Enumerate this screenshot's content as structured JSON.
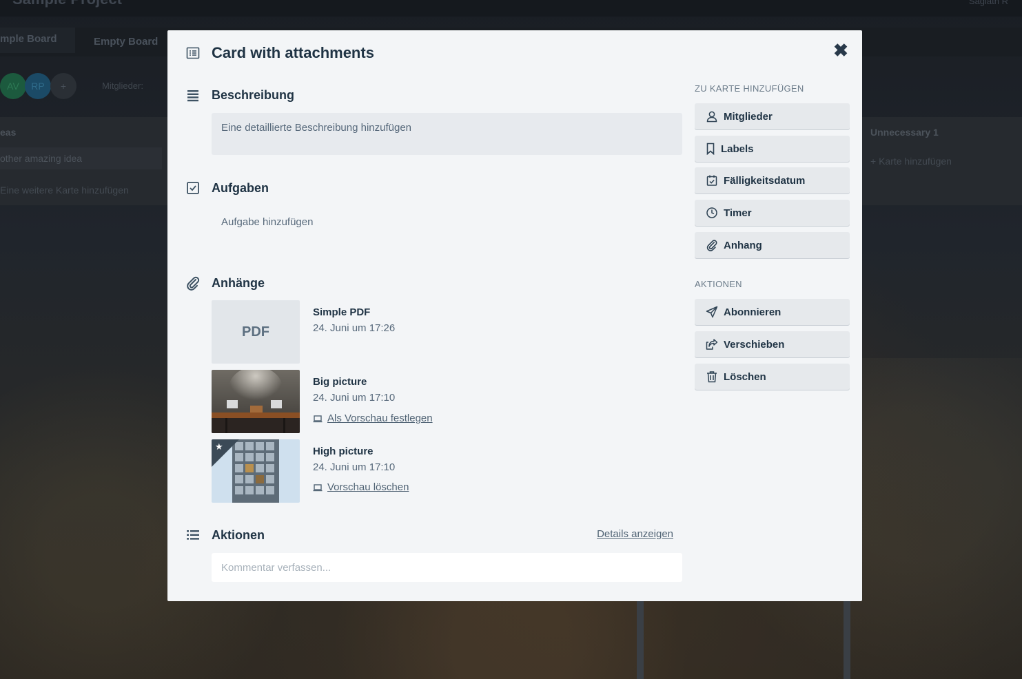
{
  "background": {
    "project_title": "Sample Project",
    "user_name": "Sagiath R",
    "tabs": [
      {
        "label": "mple Board"
      },
      {
        "label": "Empty Board"
      }
    ],
    "members": [
      {
        "initials": "AV",
        "color": "#1c5a3e"
      },
      {
        "initials": "RP",
        "color": "#1b4a66"
      }
    ],
    "members_label": "Mitglieder:",
    "left_list": {
      "title": "eas",
      "card": "other amazing idea",
      "add_label": "Eine weitere Karte hinzufügen"
    },
    "right_list": {
      "title": "Unnecessary 1",
      "add_label": "Karte hinzufügen"
    }
  },
  "modal": {
    "title": "Card with attachments",
    "title_icon": "card-icon",
    "close_icon": "close-icon",
    "description": {
      "heading": "Beschreibung",
      "placeholder": "Eine detaillierte Beschreibung hinzufügen"
    },
    "tasks": {
      "heading": "Aufgaben",
      "add_label": "Aufgabe hinzufügen"
    },
    "attachments": {
      "heading": "Anhänge",
      "items": [
        {
          "name": "Simple PDF",
          "date": "24. Juni um 17:26",
          "thumb_label": "PDF",
          "action": ""
        },
        {
          "name": "Big picture",
          "date": "24. Juni um 17:10",
          "action": "Als Vorschau festlegen"
        },
        {
          "name": "High picture",
          "date": "24. Juni um 17:10",
          "action": "Vorschau löschen",
          "is_cover": true
        }
      ]
    },
    "activity": {
      "heading": "Aktionen",
      "details_link": "Details anzeigen",
      "comment_placeholder": "Kommentar verfassen..."
    },
    "sidebar": {
      "add_heading": "ZU KARTE HINZUFÜGEN",
      "add_buttons": [
        {
          "label": "Mitglieder",
          "icon": "user-icon"
        },
        {
          "label": "Labels",
          "icon": "bookmark-icon"
        },
        {
          "label": "Fälligkeitsdatum",
          "icon": "calendar-icon"
        },
        {
          "label": "Timer",
          "icon": "clock-icon"
        },
        {
          "label": "Anhang",
          "icon": "paperclip-icon"
        }
      ],
      "actions_heading": "AKTIONEN",
      "action_buttons": [
        {
          "label": "Abonnieren",
          "icon": "send-icon"
        },
        {
          "label": "Verschieben",
          "icon": "share-icon"
        },
        {
          "label": "Löschen",
          "icon": "trash-icon"
        }
      ]
    }
  }
}
